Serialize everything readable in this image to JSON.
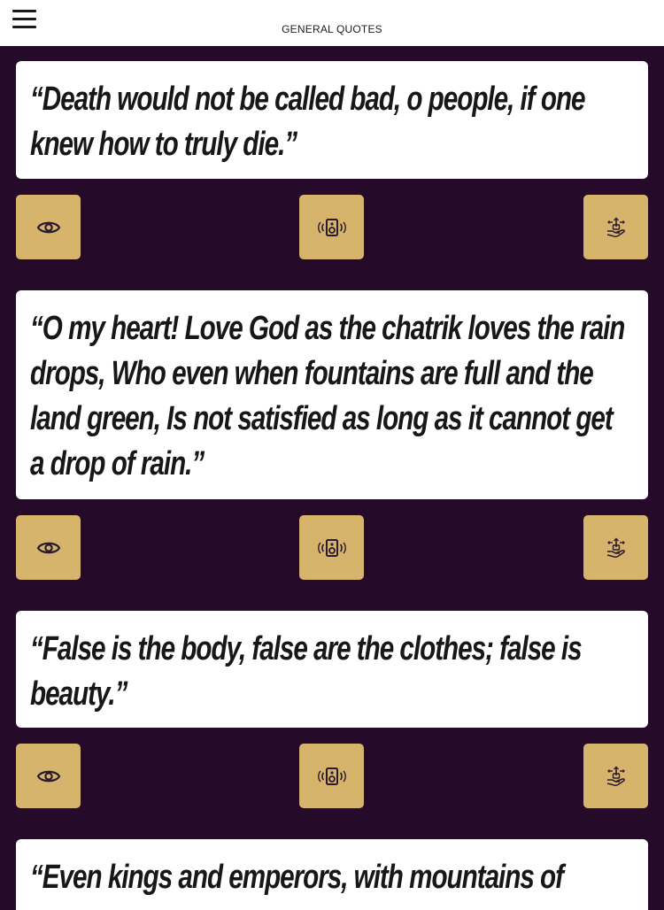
{
  "header": {
    "title": "GENERAL QUOTES",
    "menu_icon": "hamburger-menu-icon"
  },
  "quotes": [
    {
      "text": "“Death would not be called bad, o people, if one knew how to truly die.”",
      "actions": [
        "eye-icon",
        "speaker-icon",
        "share-hand-icon"
      ]
    },
    {
      "text": "“O my heart! Love God as the chatrik loves the rain drops, Who even when fountains are full and the land green, Is not satisfied as long as it cannot get a drop of rain.”",
      "actions": [
        "eye-icon",
        "speaker-icon",
        "share-hand-icon"
      ]
    },
    {
      "text": "“False is the body, false are the clothes; false is beauty.”",
      "actions": [
        "eye-icon",
        "speaker-icon",
        "share-hand-icon"
      ]
    },
    {
      "text": "“Even kings and emperors, with mountains of",
      "actions": []
    }
  ],
  "colors": {
    "background": "#260a29",
    "card": "#ffffff",
    "button": "#d6b46c",
    "icon": "#2b1a2e"
  }
}
